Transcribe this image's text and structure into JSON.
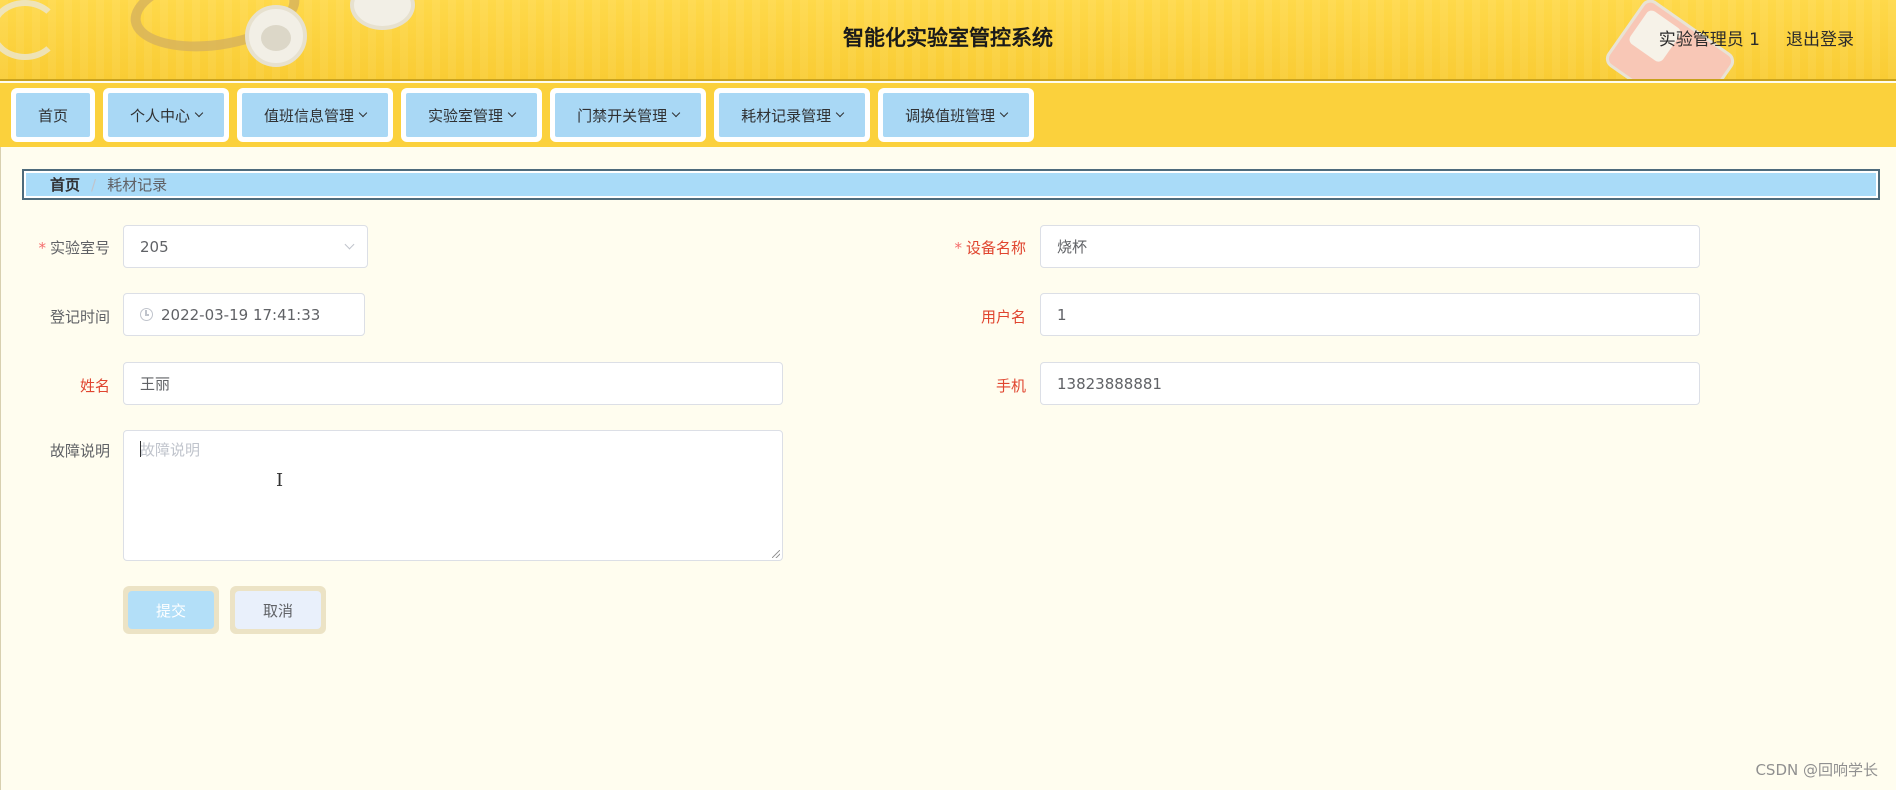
{
  "header": {
    "title": "智能化实验室管控系统",
    "user": "实验管理员 1",
    "logout": "退出登录"
  },
  "nav": {
    "items": [
      {
        "label": "首页",
        "dropdown": false
      },
      {
        "label": "个人中心",
        "dropdown": true
      },
      {
        "label": "值班信息管理",
        "dropdown": true
      },
      {
        "label": "实验室管理",
        "dropdown": true
      },
      {
        "label": "门禁开关管理",
        "dropdown": true
      },
      {
        "label": "耗材记录管理",
        "dropdown": true
      },
      {
        "label": "调换值班管理",
        "dropdown": true
      }
    ]
  },
  "breadcrumb": {
    "home": "首页",
    "separator": "/",
    "current": "耗材记录"
  },
  "form": {
    "lab_no": {
      "label": "实验室号",
      "value": "205",
      "required": true
    },
    "device_name": {
      "label": "设备名称",
      "value": "烧杯",
      "required": true
    },
    "reg_time": {
      "label": "登记时间",
      "value": "2022-03-19 17:41:33"
    },
    "username": {
      "label": "用户名",
      "value": "1"
    },
    "name": {
      "label": "姓名",
      "value": "王丽"
    },
    "phone": {
      "label": "手机",
      "value": "13823888881"
    },
    "fault": {
      "label": "故障说明",
      "placeholder": "故障说明",
      "value": ""
    },
    "submit": "提交",
    "cancel": "取消"
  },
  "watermark": "CSDN @回响学长",
  "colors": {
    "header": "#f9cc34",
    "nav_button": "#a9d8f5",
    "page_bg": "#fffdef",
    "label_red": "#e0452f"
  }
}
